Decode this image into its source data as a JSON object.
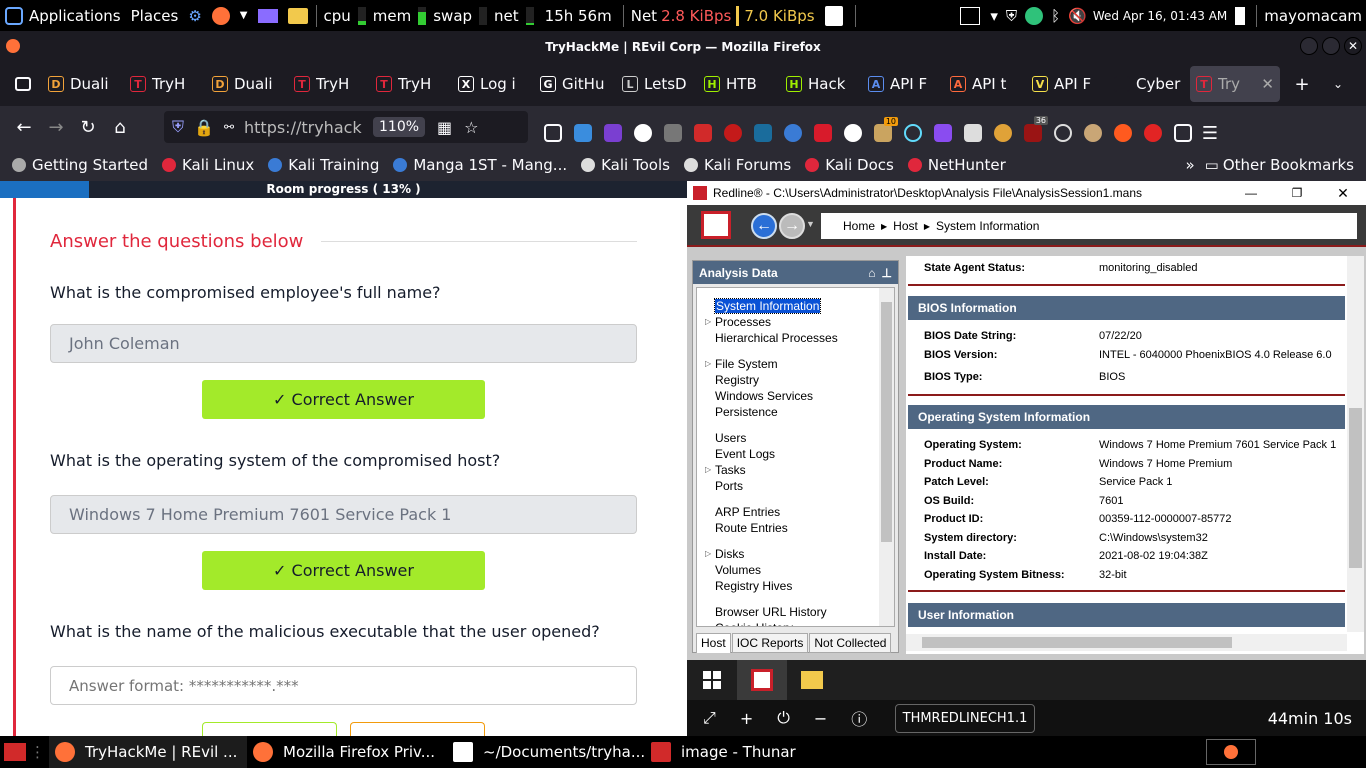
{
  "topbar": {
    "applications": "Applications",
    "places": "Places",
    "cpu": "cpu",
    "mem": "mem",
    "swap": "swap",
    "net": "net",
    "uptime": "15h 56m",
    "net_label": "Net",
    "net_down": "2.8 KiBps",
    "net_up": "7.0 KiBps",
    "datetime": "Wed Apr 16, 01:43 AM",
    "user": "mayomacam"
  },
  "browser": {
    "window_title": "TryHackMe | REvil Corp — Mozilla Firefox",
    "tabs": [
      {
        "label": "Duali",
        "color": "#f2a33a",
        "glyph": "D"
      },
      {
        "label": "TryH",
        "color": "#e0273c",
        "glyph": "T"
      },
      {
        "label": "Duali",
        "color": "#f2a33a",
        "glyph": "D"
      },
      {
        "label": "TryH",
        "color": "#e0273c",
        "glyph": "T"
      },
      {
        "label": "TryH",
        "color": "#e0273c",
        "glyph": "T"
      },
      {
        "label": "Log i",
        "color": "#ffffff",
        "glyph": "X"
      },
      {
        "label": "GitHu",
        "color": "#ffffff",
        "glyph": "G"
      },
      {
        "label": "LetsD",
        "color": "#cccccc",
        "glyph": "L"
      },
      {
        "label": "HTB",
        "color": "#9fef00",
        "glyph": "H"
      },
      {
        "label": "Hack",
        "color": "#9fef00",
        "glyph": "H"
      },
      {
        "label": "API F",
        "color": "#5b8def",
        "glyph": "A"
      },
      {
        "label": "API t",
        "color": "#ff6a3d",
        "glyph": "A"
      },
      {
        "label": "API F",
        "color": "#f5e04a",
        "glyph": "V"
      },
      {
        "label": "Cyber S",
        "color": "#1c1b22",
        "glyph": ""
      },
      {
        "label": "Try",
        "color": "#e0273c",
        "glyph": "T",
        "active": true
      }
    ],
    "url": "https://tryhack",
    "zoom": "110%",
    "badge_count": "36",
    "badge_count2": "10",
    "bookmarks": [
      {
        "label": "Getting Started",
        "color": "#aaaaaa"
      },
      {
        "label": "Kali Linux",
        "color": "#e0273c"
      },
      {
        "label": "Kali Training",
        "color": "#3a7bd5"
      },
      {
        "label": "Manga 1ST - Mang...",
        "color": "#3a7bd5"
      },
      {
        "label": "Kali Tools",
        "color": "#dddddd"
      },
      {
        "label": "Kali Forums",
        "color": "#dddddd"
      },
      {
        "label": "Kali Docs",
        "color": "#e0273c"
      },
      {
        "label": "NetHunter",
        "color": "#e0273c"
      }
    ],
    "other_bookmarks": "Other Bookmarks"
  },
  "room": {
    "progress_label": "Room progress ( 13% )",
    "progress_pct": 13,
    "section_title": "Answer the questions below",
    "questions": [
      {
        "text": "What is the compromised employee's full name?",
        "answer": "John Coleman",
        "button": "Correct Answer"
      },
      {
        "text": "What is the operating system of the compromised host?",
        "answer": "Windows 7 Home Premium 7601 Service Pack 1",
        "button": "Correct Answer"
      },
      {
        "text": "What is the name of the malicious executable that the user opened?",
        "placeholder": "Answer format: ***********.***"
      }
    ]
  },
  "redline": {
    "title": "Redline® - C:\\Users\\Administrator\\Desktop\\Analysis File\\AnalysisSession1.mans",
    "crumbs": [
      "Home",
      "Host",
      "System Information"
    ],
    "panel_title": "Analysis Data",
    "tree": [
      {
        "label": "System Information",
        "selected": true
      },
      {
        "label": "Processes",
        "arrow": true
      },
      {
        "label": "Hierarchical Processes"
      },
      {
        "label": "File System",
        "arrow": true,
        "gap": true
      },
      {
        "label": "Registry"
      },
      {
        "label": "Windows Services"
      },
      {
        "label": "Persistence"
      },
      {
        "label": "Users",
        "gap": true
      },
      {
        "label": "Event Logs"
      },
      {
        "label": "Tasks",
        "arrow": true
      },
      {
        "label": "Ports"
      },
      {
        "label": "ARP Entries",
        "gap": true
      },
      {
        "label": "Route Entries"
      },
      {
        "label": "Disks",
        "arrow": true,
        "gap": true
      },
      {
        "label": "Volumes"
      },
      {
        "label": "Registry Hives"
      },
      {
        "label": "Browser URL History",
        "gap": true
      },
      {
        "label": "Cookie History"
      }
    ],
    "bottom_tabs": [
      "Host",
      "IOC Reports",
      "Not Collected"
    ],
    "state_agent": {
      "key": "State Agent Status:",
      "value": "monitoring_disabled"
    },
    "bios_title": "BIOS Information",
    "bios": [
      {
        "key": "BIOS Date String:",
        "value": "07/22/20"
      },
      {
        "key": "BIOS Version:",
        "value": "INTEL  - 6040000 PhoenixBIOS 4.0 Release 6.0"
      },
      {
        "key": "BIOS Type:",
        "value": "BIOS"
      }
    ],
    "os_title": "Operating System Information",
    "os": [
      {
        "key": "Operating System:",
        "value": "Windows 7 Home Premium 7601 Service Pack 1"
      },
      {
        "key": "Product Name:",
        "value": "Windows 7 Home Premium"
      },
      {
        "key": "Patch Level:",
        "value": "Service Pack 1"
      },
      {
        "key": "OS Build:",
        "value": "7601"
      },
      {
        "key": "Product ID:",
        "value": "00359-112-0000007-85772"
      },
      {
        "key": "System directory:",
        "value": "C:\\Windows\\system32"
      },
      {
        "key": "Install Date:",
        "value": "2021-08-02 19:04:38Z"
      },
      {
        "key": "Operating System Bitness:",
        "value": "32-bit"
      }
    ],
    "user_title": "User Information"
  },
  "vm": {
    "machine_name": "THMREDLINECH1.1",
    "timer": "44min 10s"
  },
  "taskbar": {
    "items": [
      {
        "label": "TryHackMe | REvil ..."
      },
      {
        "label": "Mozilla Firefox Priv..."
      },
      {
        "label": "~/Documents/tryha..."
      },
      {
        "label": "image - Thunar"
      }
    ]
  }
}
